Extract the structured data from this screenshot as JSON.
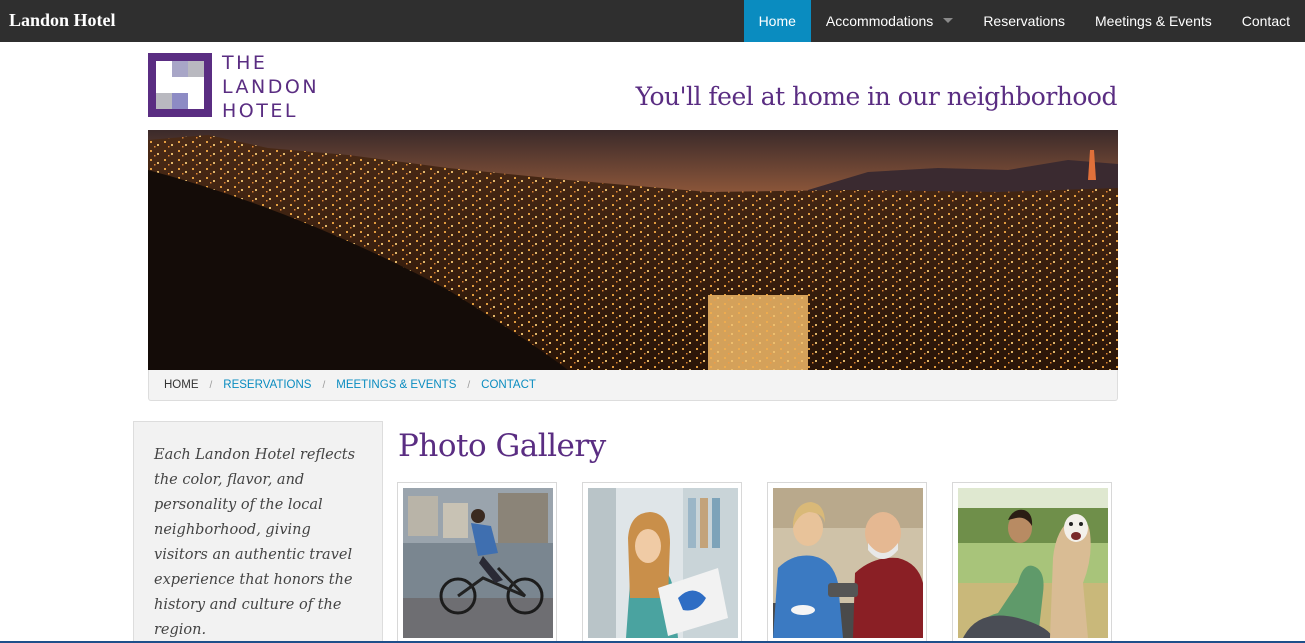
{
  "navbar": {
    "brand": "Landon Hotel",
    "items": [
      {
        "label": "Home",
        "active": true
      },
      {
        "label": "Accommodations",
        "dropdown": true
      },
      {
        "label": "Reservations"
      },
      {
        "label": "Meetings & Events"
      },
      {
        "label": "Contact"
      }
    ]
  },
  "header": {
    "logo_lines": [
      "THE",
      "LANDON",
      "HOTEL"
    ],
    "tagline": "You'll feel at home in our neighborhood"
  },
  "breadcrumb": {
    "items": [
      "HOME",
      "RESERVATIONS",
      "MEETINGS & EVENTS",
      "CONTACT"
    ],
    "separator": "/"
  },
  "sidebar": {
    "text": "Each Landon Hotel reflects the color, flavor, and personality of the local neighborhood, giving visitors an authentic travel experience that honors the history and culture of the region."
  },
  "gallery": {
    "title": "Photo Gallery"
  },
  "colors": {
    "brand_purple": "#5a2d82",
    "accent_blue": "#0a8cc0",
    "navbar_bg": "#2f2f2f"
  }
}
